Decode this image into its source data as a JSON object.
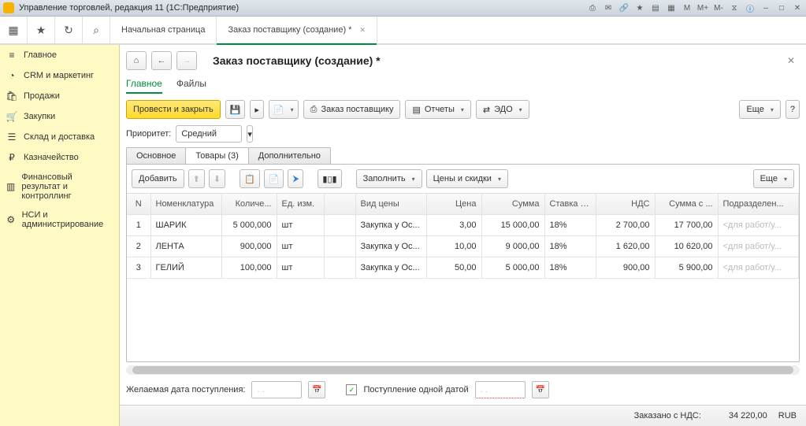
{
  "title": "Управление торговлей, редакция 11  (1С:Предприятие)",
  "ribbon": {
    "start_tab": "Начальная страница",
    "doc_tab": "Заказ поставщику (создание) *"
  },
  "sidebar": {
    "items": [
      {
        "icon": "≡",
        "label": "Главное"
      },
      {
        "icon": "◔",
        "label": "CRM и маркетинг"
      },
      {
        "icon": "🛍",
        "label": "Продажи"
      },
      {
        "icon": "🛒",
        "label": "Закупки"
      },
      {
        "icon": "☰",
        "label": "Склад и доставка"
      },
      {
        "icon": "₽",
        "label": "Казначейство"
      },
      {
        "icon": "▥",
        "label": "Финансовый результат и контроллинг"
      },
      {
        "icon": "⚙",
        "label": "НСИ и администрирование"
      }
    ]
  },
  "page": {
    "title": "Заказ поставщику (создание) *",
    "tabs": {
      "main": "Главное",
      "files": "Файлы"
    },
    "toolbar": {
      "post_close": "Провести и закрыть",
      "order_supplier": "Заказ поставщику",
      "reports": "Отчеты",
      "edo": "ЭДО",
      "more": "Еще"
    },
    "priority": {
      "label": "Приоритет:",
      "value": "Средний"
    },
    "subtabs": {
      "basic": "Основное",
      "goods": "Товары (3)",
      "extra": "Дополнительно"
    },
    "grid_toolbar": {
      "add": "Добавить",
      "fill": "Заполнить",
      "prices": "Цены и скидки",
      "more": "Еще"
    },
    "columns": {
      "n": "N",
      "nom": "Номенклатура",
      "qty": "Количе...",
      "unit": "Ед. изм.",
      "price_type": "Вид цены",
      "price": "Цена",
      "sum": "Сумма",
      "vat_rate": "Ставка Н...",
      "vat": "НДС",
      "sum_vat": "Сумма с ...",
      "dept": "Подразделен..."
    },
    "rows": [
      {
        "n": "1",
        "nom": "ШАРИК",
        "qty": "5 000,000",
        "unit": "шт",
        "ptype": "Закупка у Ос...",
        "price": "3,00",
        "sum": "15 000,00",
        "vr": "18%",
        "vat": "2 700,00",
        "sv": "17 700,00",
        "dept": "<для работ/у..."
      },
      {
        "n": "2",
        "nom": "ЛЕНТА",
        "qty": "900,000",
        "unit": "шт",
        "ptype": "Закупка у Ос...",
        "price": "10,00",
        "sum": "9 000,00",
        "vr": "18%",
        "vat": "1 620,00",
        "sv": "10 620,00",
        "dept": "<для работ/у..."
      },
      {
        "n": "3",
        "nom": "ГЕЛИЙ",
        "qty": "100,000",
        "unit": "шт",
        "ptype": "Закупка у Ос...",
        "price": "50,00",
        "sum": "5 000,00",
        "vr": "18%",
        "vat": "900,00",
        "sv": "5 900,00",
        "dept": "<для работ/у..."
      }
    ],
    "bottom": {
      "desired_date_label": "Желаемая дата поступления:",
      "date_placeholder": " .  .    ",
      "single_date_label": "Поступление одной датой",
      "single_date_checked": true
    },
    "footer": {
      "label": "Заказано с НДС:",
      "amount": "34 220,00",
      "currency": "RUB"
    }
  }
}
